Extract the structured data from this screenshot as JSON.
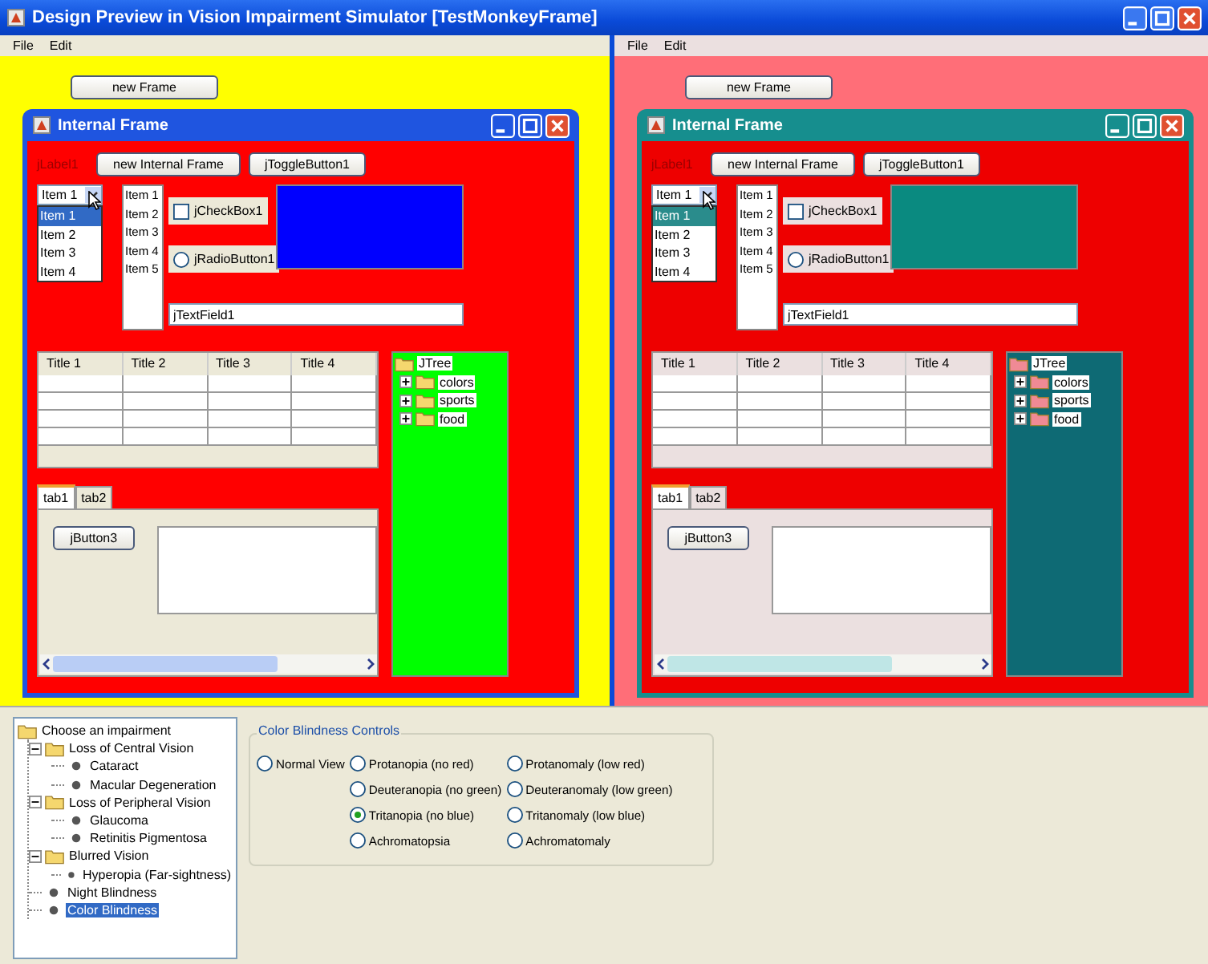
{
  "window": {
    "title": "Design Preview in Vision Impairment Simulator [TestMonkeyFrame]"
  },
  "previews": [
    {
      "kind": "original",
      "menu": [
        "File",
        "Edit"
      ],
      "new_frame_button": "new Frame",
      "internal_frame": {
        "title": "Internal Frame",
        "label": "jLabel1",
        "button": "new Internal Frame",
        "toggle_button": {
          "label": "jToggleButton1",
          "selected": false
        },
        "combo": {
          "value": "Item 1",
          "options": [
            {
              "label": "Item 1",
              "selected": true
            },
            {
              "label": "Item 2",
              "selected": false
            },
            {
              "label": "Item 3",
              "selected": false
            },
            {
              "label": "Item 4",
              "selected": false
            }
          ]
        },
        "list": [
          "Item 1",
          "Item 2",
          "Item 3",
          "Item 4",
          "Item 5"
        ],
        "checkbox": {
          "label": "jCheckBox1",
          "checked": false
        },
        "radio": {
          "label": "jRadioButton1",
          "selected": false
        },
        "text_field": {
          "value": "jTextField1"
        },
        "table": {
          "columns": [
            "Title 1",
            "Title 2",
            "Title 3",
            "Title 4"
          ]
        },
        "tabs": [
          {
            "label": "tab1",
            "selected": true
          },
          {
            "label": "tab2",
            "selected": false
          }
        ],
        "tab_button": "jButton3",
        "tree": {
          "label": "JTree",
          "children": [
            {
              "label": "colors",
              "expanded": false
            },
            {
              "label": "sports",
              "expanded": false
            },
            {
              "label": "food",
              "expanded": false
            }
          ]
        }
      }
    },
    {
      "kind": "simulated",
      "menu": [
        "File",
        "Edit"
      ],
      "new_frame_button": "new Frame",
      "internal_frame": {
        "title": "Internal Frame",
        "label": "jLabel1",
        "button": "new Internal Frame",
        "toggle_button": {
          "label": "jToggleButton1",
          "selected": false
        },
        "combo": {
          "value": "Item 1",
          "options": [
            {
              "label": "Item 1",
              "selected": true
            },
            {
              "label": "Item 2",
              "selected": false
            },
            {
              "label": "Item 3",
              "selected": false
            },
            {
              "label": "Item 4",
              "selected": false
            }
          ]
        },
        "list": [
          "Item 1",
          "Item 2",
          "Item 3",
          "Item 4",
          "Item 5"
        ],
        "checkbox": {
          "label": "jCheckBox1",
          "checked": false
        },
        "radio": {
          "label": "jRadioButton1",
          "selected": false
        },
        "text_field": {
          "value": "jTextField1"
        },
        "table": {
          "columns": [
            "Title 1",
            "Title 2",
            "Title 3",
            "Title 4"
          ]
        },
        "tabs": [
          {
            "label": "tab1",
            "selected": true
          },
          {
            "label": "tab2",
            "selected": false
          }
        ],
        "tab_button": "jButton3",
        "tree": {
          "label": "JTree",
          "children": [
            {
              "label": "colors",
              "expanded": false
            },
            {
              "label": "sports",
              "expanded": false
            },
            {
              "label": "food",
              "expanded": false
            }
          ]
        }
      }
    }
  ],
  "impairment_tree": {
    "label": "Choose an impairment",
    "children": [
      {
        "label": "Loss of Central Vision",
        "expanded": true,
        "selected": false,
        "children": [
          {
            "label": "Cataract",
            "selected": false
          },
          {
            "label": "Macular Degeneration",
            "selected": false
          }
        ]
      },
      {
        "label": "Loss of Peripheral Vision",
        "expanded": true,
        "selected": false,
        "children": [
          {
            "label": "Glaucoma",
            "selected": false
          },
          {
            "label": "Retinitis Pigmentosa",
            "selected": false
          }
        ]
      },
      {
        "label": "Blurred Vision",
        "expanded": true,
        "selected": false,
        "children": [
          {
            "label": "Hyperopia (Far-sightness)",
            "selected": false
          }
        ]
      },
      {
        "label": "Night Blindness",
        "selected": false
      },
      {
        "label": "Color Blindness",
        "selected": true
      }
    ]
  },
  "controls": {
    "title": "Color Blindness Controls",
    "columns": [
      [
        {
          "label": "Normal View",
          "selected": false
        }
      ],
      [
        {
          "label": "Protanopia (no red)",
          "selected": false
        },
        {
          "label": "Deuteranopia (no green)",
          "selected": false
        },
        {
          "label": "Tritanopia (no blue)",
          "selected": true
        },
        {
          "label": "Achromatopsia",
          "selected": false
        }
      ],
      [
        {
          "label": "Protanomaly (low red)",
          "selected": false
        },
        {
          "label": "Deuteranomaly (low green)",
          "selected": false
        },
        {
          "label": "Tritanomaly (low blue)",
          "selected": false
        },
        {
          "label": "Achromatomaly",
          "selected": false
        }
      ]
    ]
  }
}
